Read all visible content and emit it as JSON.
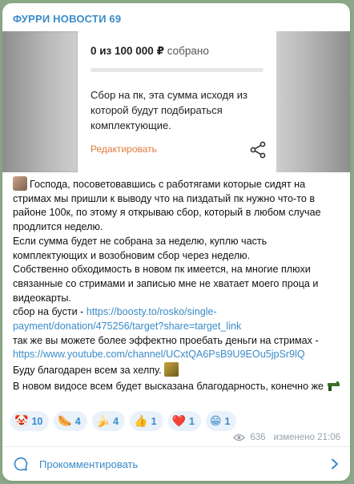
{
  "channel": {
    "title": "ФУРРИ НОВОСТИ 69"
  },
  "donation_card": {
    "amount_text": "0 из 100 000 ₽",
    "amount_suffix": "собрано",
    "progress": 0,
    "description": "Сбор на пк, эта сумма исходя из которой будут подбираться комплектующие.",
    "edit_label": "Редактировать"
  },
  "body": {
    "p1": "Господа, посоветовавшись с работягами которые сидят на стримах мы пришли к выводу что на пиздатый пк нужно что-то в районе 100к, по этому я открываю сбор, который в любом случае продлится неделю.",
    "p2": "Если сумма будет не собрана за неделю, куплю часть комплектующих и возобновим сбор через неделю.",
    "p3": "Собственно обходимость в новом пк имеется, на многие плюхи связанные со стримами и записью мне не хватает моего проца и видеокарты.",
    "p4_prefix": "сбор на бусти - ",
    "p4_link": "https://boosty.to/rosko/single-payment/donation/475256/target?share=target_link",
    "p5_prefix": "так же вы можете более эффектно проебать деньги на стримах - ",
    "p5_link": "https://www.youtube.com/channel/UCxtQA6PsB9U9EOu5jpSr9lQ",
    "p6": "Буду благодарен всем за хелпу.",
    "p7": "В новом видосе всем будет высказана благодарность, конечно же"
  },
  "reactions": [
    {
      "emoji": "🤡",
      "count": "10"
    },
    {
      "emoji": "🌭",
      "count": "4"
    },
    {
      "emoji": "🍌",
      "count": "4"
    },
    {
      "emoji": "👍",
      "count": "1"
    },
    {
      "emoji": "❤️",
      "count": "1"
    },
    {
      "emoji": "😁",
      "count": "1"
    }
  ],
  "meta": {
    "views": "636",
    "edited_time": "изменено 21:06"
  },
  "comments": {
    "label": "Прокомментировать"
  },
  "colors": {
    "accent": "#3a8bc8",
    "edit_orange": "#e07a3c",
    "reaction_bg": "#e9f2fb"
  }
}
